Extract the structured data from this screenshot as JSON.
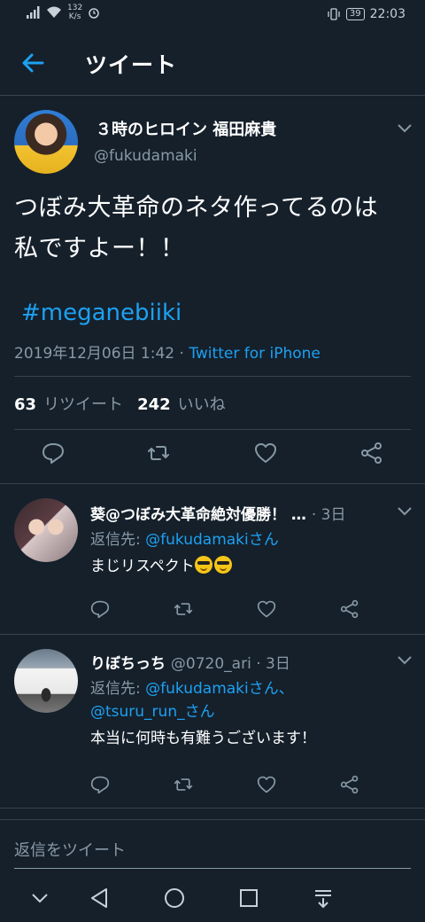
{
  "status_bar": {
    "net_speed_value": "132",
    "net_speed_unit": "K/s",
    "battery": "39",
    "time": "22:03"
  },
  "header": {
    "title": "ツイート"
  },
  "tweet": {
    "display_name": "３時のヒロイン 福田麻貴",
    "handle": "@fukudamaki",
    "text_line1": "つぼみ大革命のネタ作ってるのは",
    "text_line2": "私ですよー！！",
    "hashtag": "#meganebiiki",
    "timestamp": "2019年12月06日 1:42 · ",
    "source": "Twitter for iPhone",
    "retweet_count": "63",
    "retweet_label": "リツイート",
    "like_count": "242",
    "like_label": "いいね"
  },
  "replies": [
    {
      "name": "葵@つぼみ大革命絶対優勝！ …",
      "time": "· 3日",
      "reply_prefix": "返信先: ",
      "reply_to": "@fukudamaki",
      "reply_suffix": "さん",
      "text": "まじリスペクト"
    },
    {
      "name": "りぼちっち",
      "handle_time": "@0720_ari · 3日",
      "reply_prefix": "返信先: ",
      "reply_to": "@fukudamaki",
      "reply_suffix": "さん、",
      "reply_to2": "@tsuru_run_",
      "reply_suffix2": "さん",
      "text": "本当に何時も有難うございます！"
    }
  ],
  "reply_box": {
    "placeholder": "返信をツイート"
  },
  "colors": {
    "background": "#15202b",
    "accent": "#1da1f2",
    "muted": "#8899a6",
    "border": "#38444d"
  }
}
